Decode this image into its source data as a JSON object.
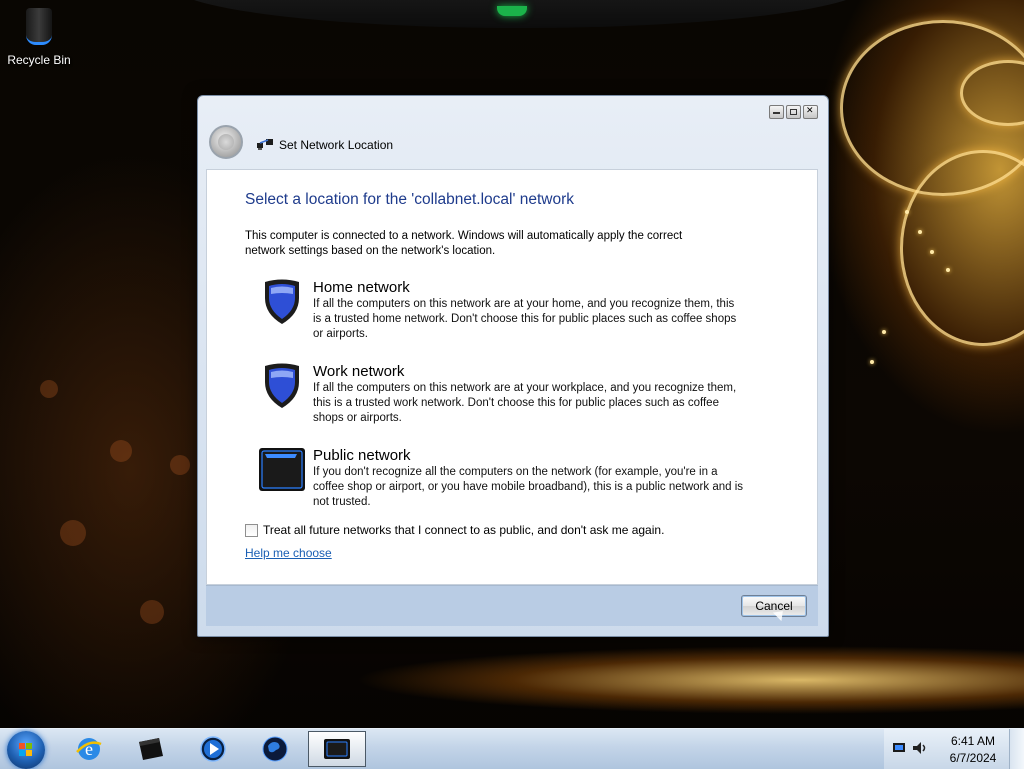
{
  "desktop": {
    "icons": [
      {
        "label": "Recycle Bin",
        "icon": "recycle-bin-icon"
      }
    ]
  },
  "window": {
    "title": "Set Network Location",
    "controls": [
      "minimize",
      "maximize",
      "close"
    ],
    "main_instruction": "Select a location for the 'collabnet.local' network",
    "intro": "This computer is connected to a network. Windows will automatically apply the correct network settings based on the network's location.",
    "options": [
      {
        "title": "Home network",
        "icon": "home-network-shield-icon",
        "description": "If all the computers on this network are at your home, and you recognize them, this is a trusted home network.  Don't choose this for public places such as coffee shops or airports."
      },
      {
        "title": "Work network",
        "icon": "work-network-shield-icon",
        "description": "If all the computers on this network are at your workplace, and you recognize them, this is a trusted work network.  Don't choose this for public places such as coffee shops or airports."
      },
      {
        "title": "Public network",
        "icon": "public-network-bench-icon",
        "description": "If you don't recognize all the computers on the network (for example, you're in a coffee shop or airport, or you have mobile broadband), this is a public network and is not trusted."
      }
    ],
    "checkbox": {
      "label": "Treat all future networks that I connect to as public, and don't ask me again.",
      "checked": false
    },
    "help_link": "Help me choose",
    "cancel_label": "Cancel"
  },
  "taskbar": {
    "items": [
      {
        "name": "internet-explorer-icon",
        "active": false
      },
      {
        "name": "dark-window-app-icon",
        "active": false
      },
      {
        "name": "media-player-icon",
        "active": false
      },
      {
        "name": "globe-icon",
        "active": false
      },
      {
        "name": "network-location-app-icon",
        "active": true
      }
    ],
    "clock": {
      "time": "6:41 AM",
      "date": "6/7/2024"
    }
  },
  "colors": {
    "accent_heading": "#1e3b8c",
    "link": "#1a5fb4",
    "shield_blue": "#2e4fd6"
  }
}
